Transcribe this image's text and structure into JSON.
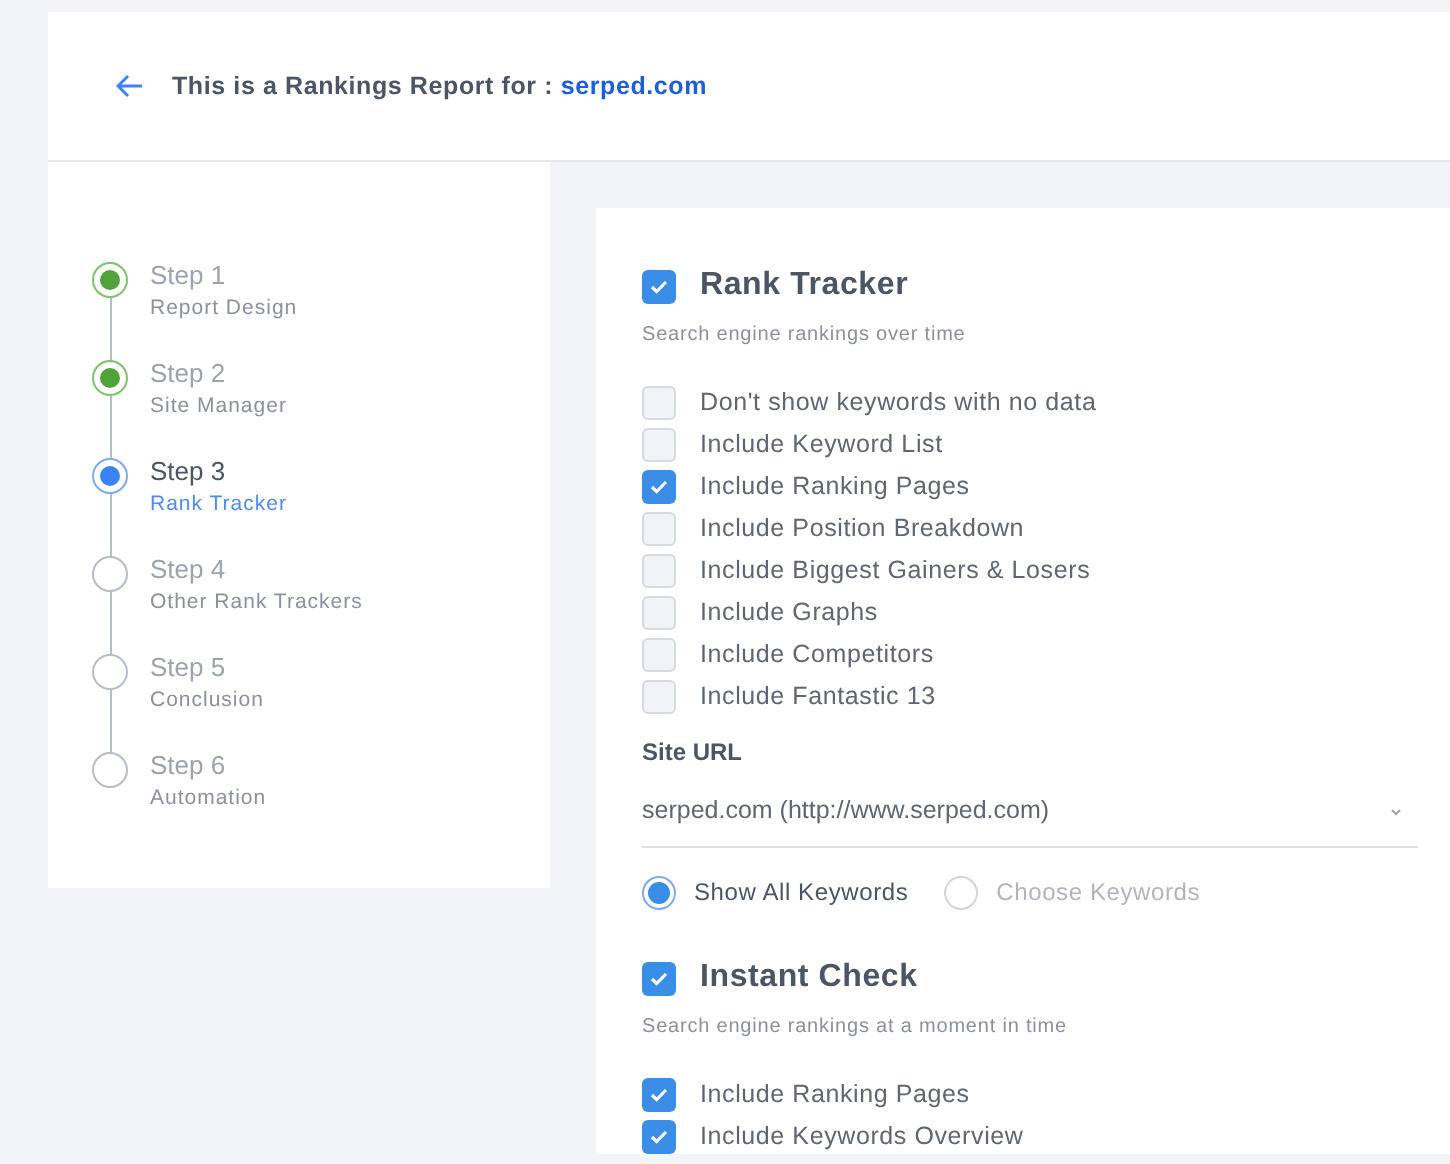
{
  "header": {
    "title": "This is a Rankings Report for :",
    "site": "serped.com"
  },
  "steps": [
    {
      "label": "Step 1",
      "name": "Report Design",
      "completed": true,
      "selected": false
    },
    {
      "label": "Step 2",
      "name": "Site Manager",
      "completed": true,
      "selected": false
    },
    {
      "label": "Step 3",
      "name": "Rank Tracker",
      "completed": false,
      "selected": true
    },
    {
      "label": "Step 4",
      "name": "Other Rank Trackers",
      "completed": false,
      "selected": false
    },
    {
      "label": "Step 5",
      "name": "Conclusion",
      "completed": false,
      "selected": false
    },
    {
      "label": "Step 6",
      "name": "Automation",
      "completed": false,
      "selected": false
    }
  ],
  "rank_tracker": {
    "title": "Rank Tracker",
    "checked": true,
    "subtitle": "Search engine rankings over time",
    "options": [
      {
        "label": "Don't show keywords with no data",
        "checked": false
      },
      {
        "label": "Include Keyword List",
        "checked": false
      },
      {
        "label": "Include Ranking Pages",
        "checked": true
      },
      {
        "label": "Include Position Breakdown",
        "checked": false
      },
      {
        "label": "Include Biggest Gainers & Losers",
        "checked": false
      },
      {
        "label": "Include Graphs",
        "checked": false
      },
      {
        "label": "Include Competitors",
        "checked": false
      },
      {
        "label": "Include Fantastic 13",
        "checked": false
      }
    ],
    "site_url": {
      "label": "Site URL",
      "value": "serped.com (http://www.serped.com)"
    },
    "keyword_mode": [
      {
        "label": "Show All Keywords",
        "selected": true
      },
      {
        "label": "Choose Keywords",
        "selected": false
      }
    ]
  },
  "instant_check": {
    "title": "Instant Check",
    "checked": true,
    "subtitle": "Search engine rankings at a moment in time",
    "options": [
      {
        "label": "Include Ranking Pages",
        "checked": true
      },
      {
        "label": "Include Keywords Overview",
        "checked": true
      }
    ]
  }
}
